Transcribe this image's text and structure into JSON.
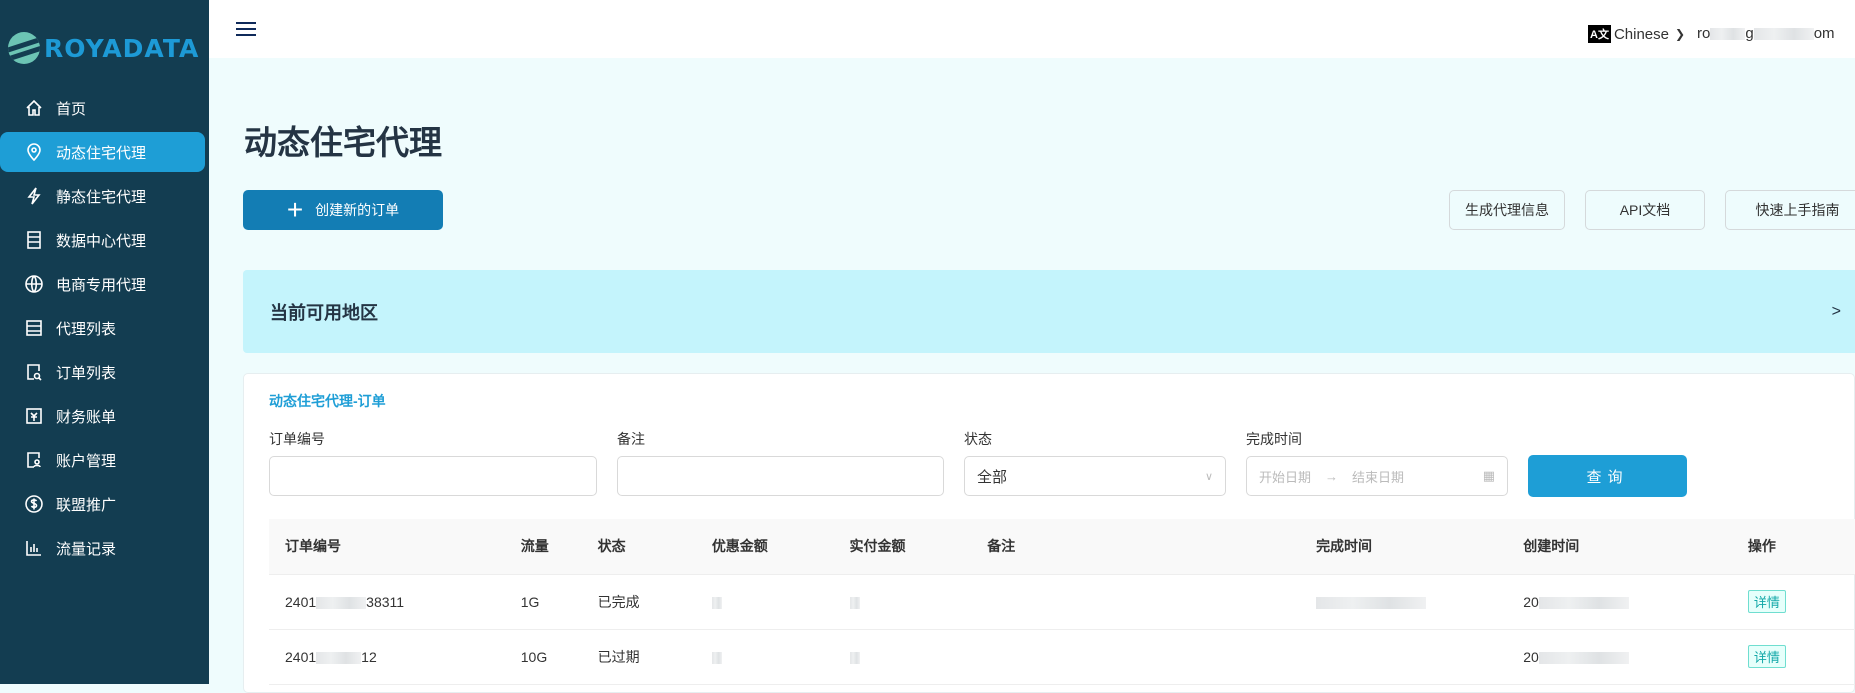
{
  "brand": "ROYADATA",
  "sidebar": {
    "items": [
      {
        "label": "首页",
        "icon": "home-icon"
      },
      {
        "label": "动态住宅代理",
        "icon": "location-pin-icon",
        "active": true
      },
      {
        "label": "静态住宅代理",
        "icon": "lightning-icon"
      },
      {
        "label": "数据中心代理",
        "icon": "server-icon"
      },
      {
        "label": "电商专用代理",
        "icon": "globe-icon"
      },
      {
        "label": "代理列表",
        "icon": "list-icon"
      },
      {
        "label": "订单列表",
        "icon": "order-search-icon"
      },
      {
        "label": "财务账单",
        "icon": "bill-icon"
      },
      {
        "label": "账户管理",
        "icon": "account-icon"
      },
      {
        "label": "联盟推广",
        "icon": "dollar-icon"
      },
      {
        "label": "流量记录",
        "icon": "bar-chart-icon"
      }
    ]
  },
  "header": {
    "language": "Chinese",
    "user_prefix": "ro",
    "user_mid": "g",
    "user_suffix": "om"
  },
  "page": {
    "title": "动态住宅代理",
    "create_label": "创建新的订单",
    "buttons": [
      "生成代理信息",
      "API文档",
      "快速上手指南"
    ],
    "region_label": "当前可用地区",
    "region_chevron": ">"
  },
  "orders": {
    "title": "动态住宅代理-订单",
    "filters": {
      "order_no": "订单编号",
      "remark": "备注",
      "status": "状态",
      "status_value": "全部",
      "time": "完成时间",
      "start_placeholder": "开始日期",
      "end_placeholder": "结束日期",
      "query": "查询"
    },
    "columns": [
      "订单编号",
      "流量",
      "状态",
      "优惠金额",
      "实付金额",
      "备注",
      "完成时间",
      "创建时间",
      "操作"
    ],
    "rows": [
      {
        "order_prefix": "2401",
        "order_suffix": "38311",
        "traffic": "1G",
        "status": "已完成",
        "created_prefix": "20",
        "action": "详情"
      },
      {
        "order_prefix": "2401",
        "order_suffix": "12",
        "traffic": "10G",
        "status": "已过期",
        "created_prefix": "20",
        "action": "详情"
      }
    ]
  }
}
